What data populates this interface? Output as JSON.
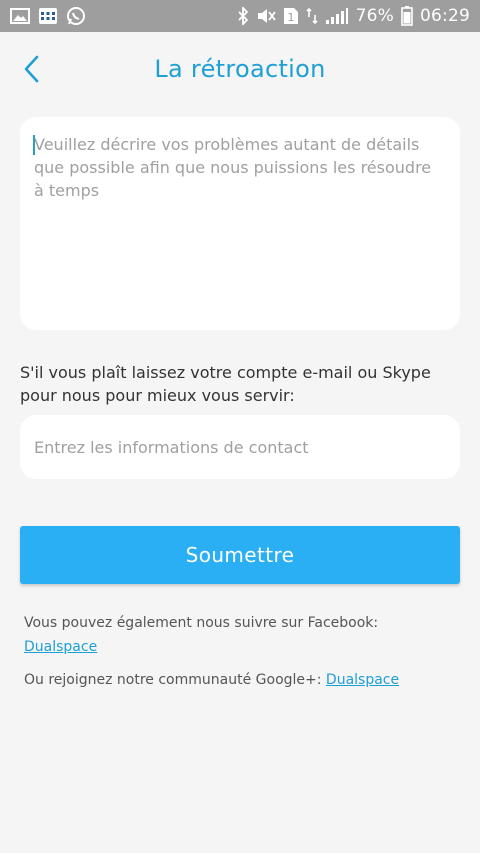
{
  "status_bar": {
    "battery": "76%",
    "time": "06:29",
    "sim_badge": "1",
    "icons": [
      "gallery-icon",
      "calendar-app-icon",
      "whatsapp-icon",
      "bluetooth-icon",
      "mute-icon",
      "sim-icon",
      "data-icon",
      "signal-icon",
      "battery-icon"
    ]
  },
  "header": {
    "title": "La rétroaction",
    "back_icon": "chevron-left-icon"
  },
  "feedback": {
    "placeholder": "Veuillez décrire vos problèmes autant de détails que possible afin que nous puissions les résoudre à temps"
  },
  "contact": {
    "label": "S'il vous plaît laissez votre compte e-mail ou Skype pour nous pour mieux vous servir:",
    "placeholder": "Entrez les informations de contact"
  },
  "submit": {
    "label": "Soumettre"
  },
  "follow": {
    "facebook_text": "Vous pouvez également nous suivre sur Facebook:",
    "facebook_link": "Dualspace",
    "google_text": "Ou rejoignez notre communauté Google+:",
    "google_link": "Dualspace"
  },
  "colors": {
    "accent": "#1e9fd6",
    "button": "#2aaef4",
    "status_bar": "#9e9e9e",
    "background": "#f5f5f5"
  }
}
